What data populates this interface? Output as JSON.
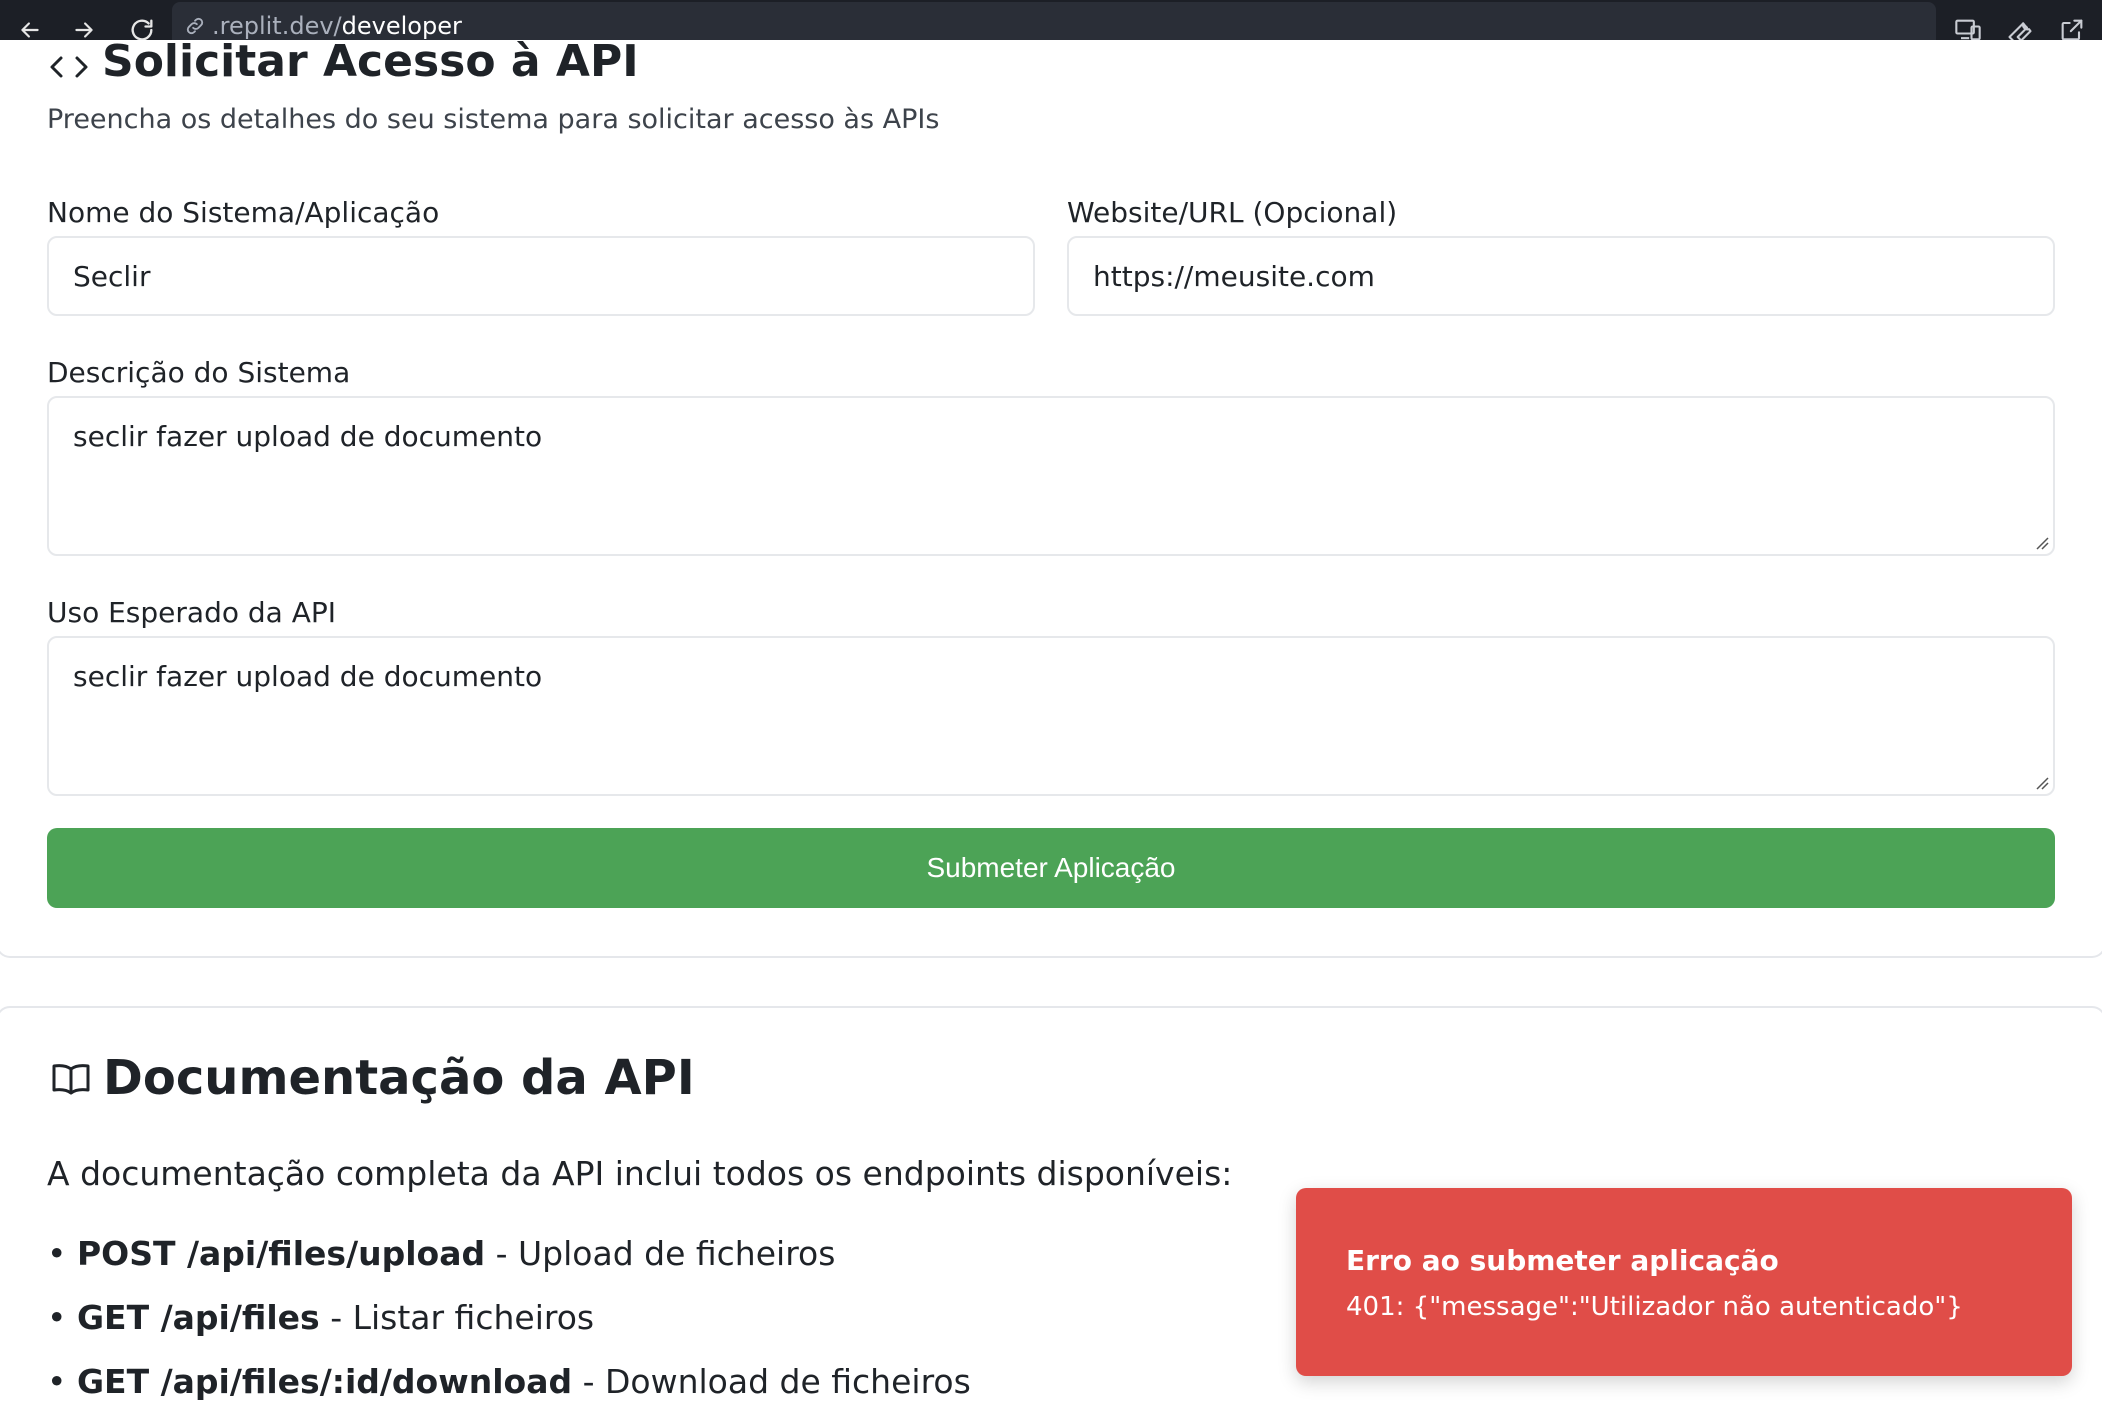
{
  "browser": {
    "url_prefix": ".replit.dev/",
    "url_path": "developer"
  },
  "request_form": {
    "title": "Solicitar Acesso à API",
    "subtitle": "Preencha os detalhes do seu sistema para solicitar acesso às APIs",
    "system_name": {
      "label": "Nome do Sistema/Aplicação",
      "value": "Seclir"
    },
    "website": {
      "label": "Website/URL (Opcional)",
      "value": "https://meusite.com"
    },
    "description": {
      "label": "Descrição do Sistema",
      "value": "seclir fazer upload de documento"
    },
    "expected_use": {
      "label": "Uso Esperado da API",
      "value": "seclir fazer upload de documento"
    },
    "submit_label": "Submeter Aplicação"
  },
  "docs": {
    "title": "Documentação da API",
    "intro": "A documentação completa da API inclui todos os endpoints disponíveis:",
    "endpoints": [
      {
        "method_path": "POST /api/files/upload",
        "desc": "Upload de ficheiros"
      },
      {
        "method_path": "GET /api/files",
        "desc": "Listar ficheiros"
      },
      {
        "method_path": "GET /api/files/:id/download",
        "desc": "Download de ficheiros"
      }
    ]
  },
  "toast": {
    "title": "Erro ao submeter aplicação",
    "message": "401: {\"message\":\"Utilizador não autenticado\"}"
  },
  "colors": {
    "toolbar_bg": "#1c1f26",
    "submit_green": "#4ca356",
    "error_red": "#e04d48"
  }
}
